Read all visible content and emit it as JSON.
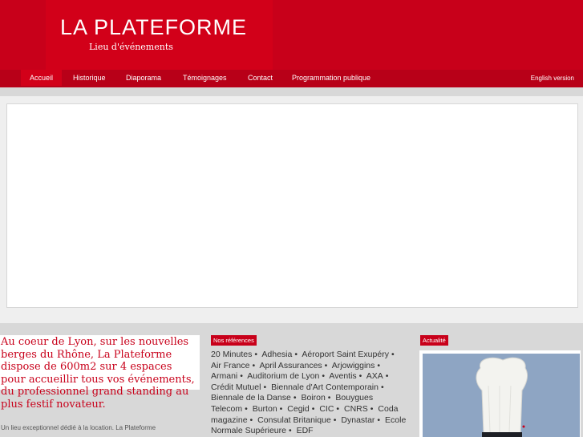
{
  "header": {
    "logo_title": "LA PLATEFORME",
    "logo_subtitle": "Lieu d'événements"
  },
  "nav": {
    "items": [
      {
        "label": "Accueil",
        "active": true
      },
      {
        "label": "Historique",
        "active": false
      },
      {
        "label": "Diaporama",
        "active": false
      },
      {
        "label": "Témoignages",
        "active": false
      },
      {
        "label": "Contact",
        "active": false
      },
      {
        "label": "Programmation publique",
        "active": false
      }
    ],
    "english_label": "English version"
  },
  "intro": {
    "headline": "Au coeur de Lyon, sur les nouvelles berges du Rhône, La Plateforme dispose de 600m2 sur 4 espaces pour accueillir tous vos événements, du professionnel grand standing au plus festif novateur.",
    "description": "Un lieu exceptionnel dédié à la location. La Plateforme"
  },
  "references": {
    "tag": "Nos références",
    "items": [
      "20 Minutes",
      "Adhesia",
      "Aéroport Saint Exupéry",
      "Air France",
      "April Assurances",
      "Arjowiggins",
      "Armani",
      "Auditorium de Lyon",
      "Aventis",
      "AXA",
      "Crédit Mutuel",
      "Biennale d'Art Contemporain",
      "Biennale de la Danse",
      "Boiron",
      "Bouygues Telecom",
      "Burton",
      "Cegid",
      "CIC",
      "CNRS",
      "Coda magazine",
      "Consulat Britanique",
      "Dynastar",
      "Ecole Normale Supérieure",
      "EDF"
    ]
  },
  "news": {
    "tag": "Actualité"
  },
  "colors": {
    "brand_red": "#c8001a",
    "nav_red": "#b80018",
    "active_red": "#d20019"
  }
}
